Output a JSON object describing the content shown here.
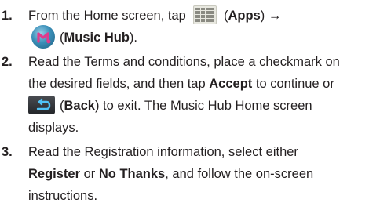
{
  "steps": [
    {
      "number": "1.",
      "line1_prefix": "From the Home screen, tap ",
      "apps_open": " (",
      "apps_label": "Apps",
      "apps_close": ")",
      "arrow": " →",
      "music_open": "(",
      "music_label": "Music Hub",
      "music_close": ")."
    },
    {
      "number": "2.",
      "line1": "Read the Terms and conditions, place a checkmark on",
      "line2_prefix": "the desired fields, and then tap ",
      "accept_label": "Accept",
      "line2_suffix": " to continue or",
      "back_open": "(",
      "back_label": "Back",
      "back_suffix": ") to exit. The Music Hub Home screen",
      "line4": "displays."
    },
    {
      "number": "3.",
      "line1": "Read the Registration information, select either",
      "register_label": "Register",
      "or_text": " or ",
      "nothanks_label": "No Thanks",
      "line2_suffix": ", and follow the on-screen",
      "line3": "instructions."
    }
  ],
  "icons": {
    "apps": "apps-grid-icon",
    "music": "music-hub-icon",
    "back": "back-arrow-icon"
  }
}
